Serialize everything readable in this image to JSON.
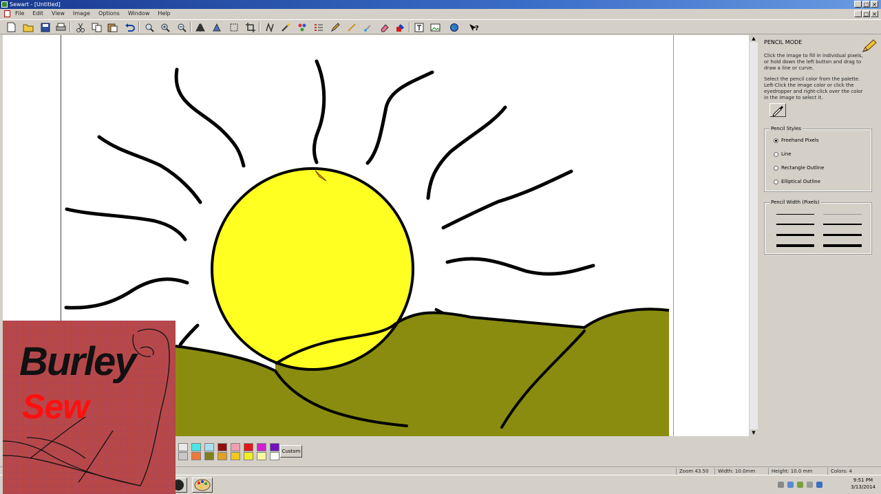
{
  "window": {
    "title": "Sewart - [Untitled]",
    "controls": [
      "_",
      "□",
      "×"
    ]
  },
  "menubar": {
    "items": [
      "File",
      "Edit",
      "View",
      "Image",
      "Options",
      "Window",
      "Help"
    ]
  },
  "toolbar": {
    "buttons": [
      "new-icon",
      "open-icon",
      "save-icon",
      "print-icon",
      "cut-icon",
      "copy-icon",
      "paste-icon",
      "undo-icon",
      "zoom-icon",
      "zoom-in-icon",
      "zoom-out-icon",
      "flip-icon",
      "rotate-icon",
      "select-icon",
      "crop-icon",
      "stitch-icon",
      "magic-wand-icon",
      "palette-icon",
      "pencil-tool-icon",
      "line-tool-icon",
      "brush-icon",
      "eraser-icon",
      "fill-icon",
      "text-icon",
      "image-icon",
      "globe-icon",
      "help-icon"
    ]
  },
  "canvas": {
    "sun_color": "#ffff22",
    "hill_color": "#8a8c10",
    "stroke_color": "#000000"
  },
  "panel": {
    "mode_title": "PENCIL MODE",
    "instruction_1": "Click the image to fill in individual pixels, or hold down the left button and drag to draw a line or curve.",
    "instruction_2": "Select the pencil color from the palette. Left-Click the image color or click the eyedropper and right-click over the color in the image to select it.",
    "style_group": {
      "legend": "Pencil Styles",
      "options": [
        "Freehand Pixels",
        "Line",
        "Rectangle Outline",
        "Elliptical Outline"
      ],
      "selected": 0
    },
    "width_group": {
      "legend": "Pencil Width (Pixels)"
    }
  },
  "palette": {
    "row1": [
      "#e8e8e8",
      "#48e8e8",
      "#a8e0f0",
      "#901010",
      "#f0a0b0",
      "#e01818",
      "#d020d0",
      "#7010c0"
    ],
    "row2": [
      "#c8c8c8",
      "#f07838",
      "#808020",
      "#e0a020",
      "#f0c820",
      "#f0f020",
      "#f8f8a0",
      "#ffffff"
    ],
    "custom_label": "Custom"
  },
  "status": {
    "zoom": "Zoom 43.50",
    "width": "Width: 10.0mm",
    "height": "Height: 10.0 mm",
    "colors": "Colors: 4"
  },
  "taskbar": {
    "time": "9:51 PM",
    "date": "3/13/2014"
  },
  "logo": {
    "word1": "Burley",
    "word2": "Sew"
  }
}
